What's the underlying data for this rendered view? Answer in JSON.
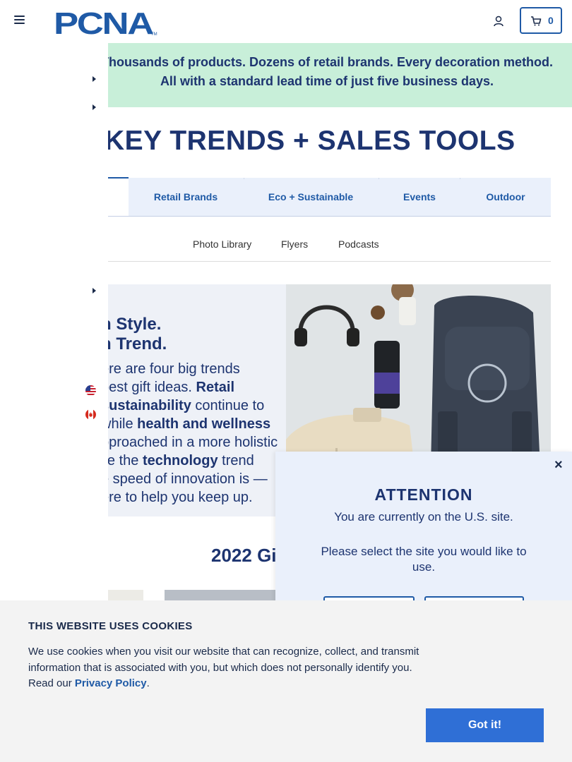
{
  "header": {
    "logo_text": "PCNA",
    "logo_tm": "TM",
    "menu_icon": "hamburger-menu-icon",
    "account_icon": "user-icon",
    "cart_icon": "cart-icon",
    "cart_count": "0"
  },
  "banner": {
    "text": "Thousands of products. Dozens of retail brands. Every decoration method. All with a standard lead time of just five business days."
  },
  "main": {
    "heading": "KEY TRENDS + SALES TOOLS",
    "tabs": [
      {
        "label": "Retail Brands"
      },
      {
        "label": "Eco + Sustainable"
      },
      {
        "label": "Events"
      },
      {
        "label": "Outdoor"
      }
    ],
    "sublinks": [
      {
        "label": "Photo Library"
      },
      {
        "label": "Flyers"
      },
      {
        "label": "Podcasts"
      }
    ]
  },
  "sidebar": {
    "flags": [
      "us-flag-icon",
      "canada-flag-icon"
    ]
  },
  "hero": {
    "line1": "n Style.",
    "line2": "n Trend.",
    "body_1": "ere are four big trends",
    "body_2": "best gift ideas. ",
    "body_bold_1": "Retail",
    "body_bold_2": " sustainability",
    "body_3": " continue to",
    "body_4": "while ",
    "body_bold_3": "health and wellness",
    "body_5": "pproached in a more holistic",
    "body_6": "ile the ",
    "body_bold_4": "technology",
    "body_7": " trend",
    "body_8": "e speed of innovation is —",
    "body_9": "ere to help you keep up."
  },
  "gifts": {
    "title": "2022 Gi"
  },
  "modal": {
    "title": "ATTENTION",
    "line1": "You are currently on the U.S. site.",
    "line2": "Please select the site you would like to use.",
    "close": "×"
  },
  "cookie": {
    "title": "THIS WEBSITE USES COOKIES",
    "text": "We use cookies when you visit our website that can recognize, collect, and transmit information that is associated with you, but which does not personally identify you. Read our ",
    "link": "Privacy Policy",
    "end": ".",
    "button": "Got it!"
  },
  "colors": {
    "navy": "#1d3470",
    "accent_blue": "#1f5aa6",
    "banner_green": "#c8efd9",
    "tab_bg": "#eaf0fb",
    "cookie_button": "#2f6fd6"
  }
}
